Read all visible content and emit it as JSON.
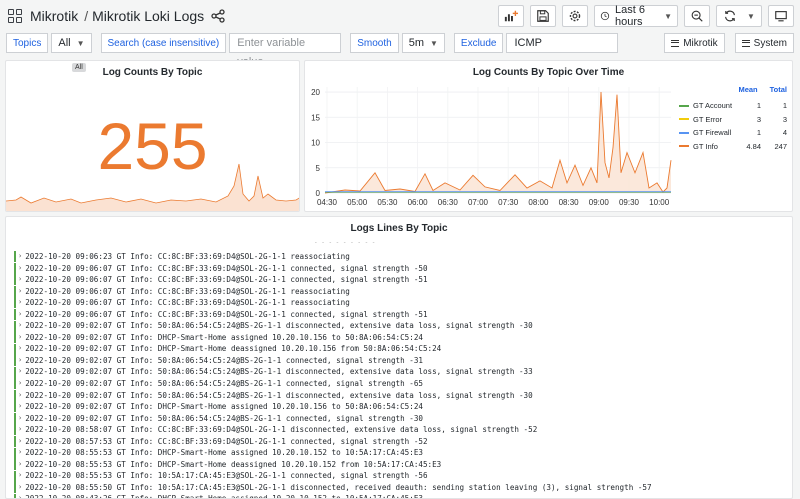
{
  "header": {
    "folder": "Mikrotik",
    "title": "Mikrotik Loki Logs",
    "time_range": "Last 6 hours"
  },
  "variables": {
    "topics_label": "Topics",
    "topics_value": "All",
    "search_label": "Search (case insensitive)",
    "search_placeholder": "Enter variable value",
    "smooth_label": "Smooth",
    "smooth_value": "5m",
    "exclude_label": "Exclude",
    "exclude_value": "ICMP",
    "row_btn_1": "Mikrotik",
    "row_btn_2": "System"
  },
  "panel_count": {
    "title": "Log Counts By Topic",
    "badge": "All",
    "value": "255",
    "color": "#eb7a30"
  },
  "panel_time": {
    "title": "Log Counts By Topic Over Time",
    "legend_headers": {
      "mean": "Mean",
      "total": "Total"
    },
    "legend": [
      {
        "name": "GT Account",
        "mean": "1",
        "total": "1",
        "color": "#56a64b"
      },
      {
        "name": "GT Error",
        "mean": "3",
        "total": "3",
        "color": "#f2cc0c"
      },
      {
        "name": "GT Firewall",
        "mean": "1",
        "total": "4",
        "color": "#5794f2"
      },
      {
        "name": "GT Info",
        "mean": "4.84",
        "total": "247",
        "color": "#eb7a30"
      }
    ]
  },
  "chart_data": {
    "type": "line",
    "x": [
      "04:30",
      "05:00",
      "05:30",
      "06:00",
      "06:30",
      "07:00",
      "07:30",
      "08:00",
      "08:30",
      "09:00",
      "09:30",
      "10:00"
    ],
    "yticks": [
      0,
      5,
      10,
      15,
      20
    ],
    "ylim": [
      0,
      21
    ],
    "legend_position": "right"
  },
  "panel_logs": {
    "title": "Logs Lines By Topic",
    "lines": [
      "2022-10-20 09:06:23 GT Info: CC:8C:BF:33:69:D4@SOL-2G-1-1 reassociating",
      "2022-10-20 09:06:07 GT Info: CC:8C:BF:33:69:D4@SOL-2G-1-1 connected, signal strength -50",
      "2022-10-20 09:06:07 GT Info: CC:8C:BF:33:69:D4@SOL-2G-1-1 connected, signal strength -51",
      "2022-10-20 09:06:07 GT Info: CC:8C:BF:33:69:D4@SOL-2G-1-1 reassociating",
      "2022-10-20 09:06:07 GT Info: CC:8C:BF:33:69:D4@SOL-2G-1-1 reassociating",
      "2022-10-20 09:06:07 GT Info: CC:8C:BF:33:69:D4@SOL-2G-1-1 connected, signal strength -51",
      "2022-10-20 09:02:07 GT Info: 50:8A:06:54:C5:24@BS-2G-1-1 disconnected, extensive data loss, signal strength -30",
      "2022-10-20 09:02:07 GT Info: DHCP-Smart-Home assigned 10.20.10.156 to 50:8A:06:54:C5:24",
      "2022-10-20 09:02:07 GT Info: DHCP-Smart-Home deassigned 10.20.10.156 from 50:8A:06:54:C5:24",
      "2022-10-20 09:02:07 GT Info: 50:8A:06:54:C5:24@BS-2G-1-1 connected, signal strength -31",
      "2022-10-20 09:02:07 GT Info: 50:8A:06:54:C5:24@BS-2G-1-1 disconnected, extensive data loss, signal strength -33",
      "2022-10-20 09:02:07 GT Info: 50:8A:06:54:C5:24@BS-2G-1-1 connected, signal strength -65",
      "2022-10-20 09:02:07 GT Info: 50:8A:06:54:C5:24@BS-2G-1-1 disconnected, extensive data loss, signal strength -30",
      "2022-10-20 09:02:07 GT Info: DHCP-Smart-Home assigned 10.20.10.156 to 50:8A:06:54:C5:24",
      "2022-10-20 09:02:07 GT Info: 50:8A:06:54:C5:24@BS-2G-1-1 connected, signal strength -30",
      "2022-10-20 08:58:07 GT Info: CC:8C:BF:33:69:D4@SOL-2G-1-1 disconnected, extensive data loss, signal strength -52",
      "2022-10-20 08:57:53 GT Info: CC:8C:BF:33:69:D4@SOL-2G-1-1 connected, signal strength -52",
      "2022-10-20 08:55:53 GT Info: DHCP-Smart-Home assigned 10.20.10.152 to 10:5A:17:CA:45:E3",
      "2022-10-20 08:55:53 GT Info: DHCP-Smart-Home deassigned 10.20.10.152 from 10:5A:17:CA:45:E3",
      "2022-10-20 08:55:53 GT Info: 10:5A:17:CA:45:E3@SOL-2G-1-1 connected, signal strength -56",
      "2022-10-20 08:55:50 GT Info: 10:5A:17:CA:45:E3@SOL-2G-1-1 disconnected, received deauth: sending station leaving (3), signal strength -57",
      "2022-10-20 08:43:26 GT Info: DHCP-Smart-Home assigned 10.20.10.152 to 10:5A:17:CA:45:E3"
    ]
  }
}
